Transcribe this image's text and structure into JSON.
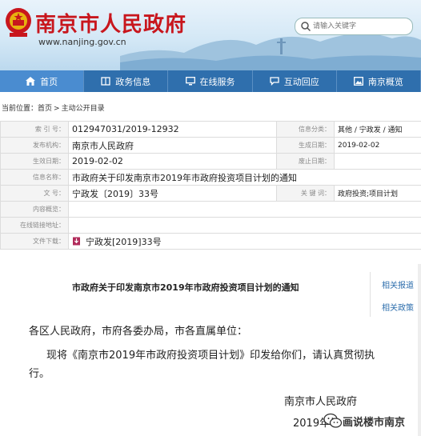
{
  "header": {
    "site_title": "南京市人民政府",
    "site_domain": "www.nanjing.gov.cn",
    "search_placeholder": "请输入关键字",
    "emblem_icon": "national-emblem-icon",
    "brand_color": "#c8161d"
  },
  "nav": {
    "items": [
      {
        "label": "首页",
        "icon": "home-icon",
        "active": true
      },
      {
        "label": "政务信息",
        "icon": "book-icon"
      },
      {
        "label": "在线服务",
        "icon": "monitor-icon"
      },
      {
        "label": "互动回应",
        "icon": "chat-icon"
      },
      {
        "label": "南京概览",
        "icon": "picture-icon"
      }
    ],
    "bar_color": "#2f6fad"
  },
  "breadcrumb": {
    "prefix": "当前位置：",
    "items": [
      "首页",
      "主动公开目录"
    ],
    "separator": ">"
  },
  "info": {
    "index_label": "索 引 号：",
    "index_value": "012947031/2019-12932",
    "category_label": "信息分类：",
    "category_value": "其他 / 宁政发 / 通知",
    "publisher_label": "发布机构：",
    "publisher_value": "南京市人民政府",
    "created_label": "生成日期：",
    "created_value": "2019-02-02",
    "effective_label": "生效日期：",
    "effective_value": "2019-02-02",
    "expiry_label": "废止日期：",
    "expiry_value": "",
    "name_label": "信息名称：",
    "name_value": "市政府关于印发南京市2019年市政府投资项目计划的通知",
    "docno_label": "文 号：",
    "docno_value": "宁政发〔2019〕33号",
    "keywords_label": "关 键 词：",
    "keywords_value": "政府投资;项目计划",
    "summary_label": "内容概览：",
    "summary_value": "",
    "link_label": "在线链接地址：",
    "link_value": "",
    "download_label": "文件下载：",
    "download_value": "宁政发[2019]33号"
  },
  "article": {
    "title": "市政府关于印发南京市2019年市政府投资项目计划的通知",
    "salutation": "各区人民政府，市府各委办局，市各直属单位：",
    "body": "现将《南京市2019年市政府投资项目计划》印发给你们，请认真贯彻执行。",
    "signature": "南京市人民政府",
    "date_partial": "2019年",
    "related": [
      "相关报道",
      "相关政策"
    ]
  },
  "watermark": {
    "text": "画说楼市南京"
  }
}
